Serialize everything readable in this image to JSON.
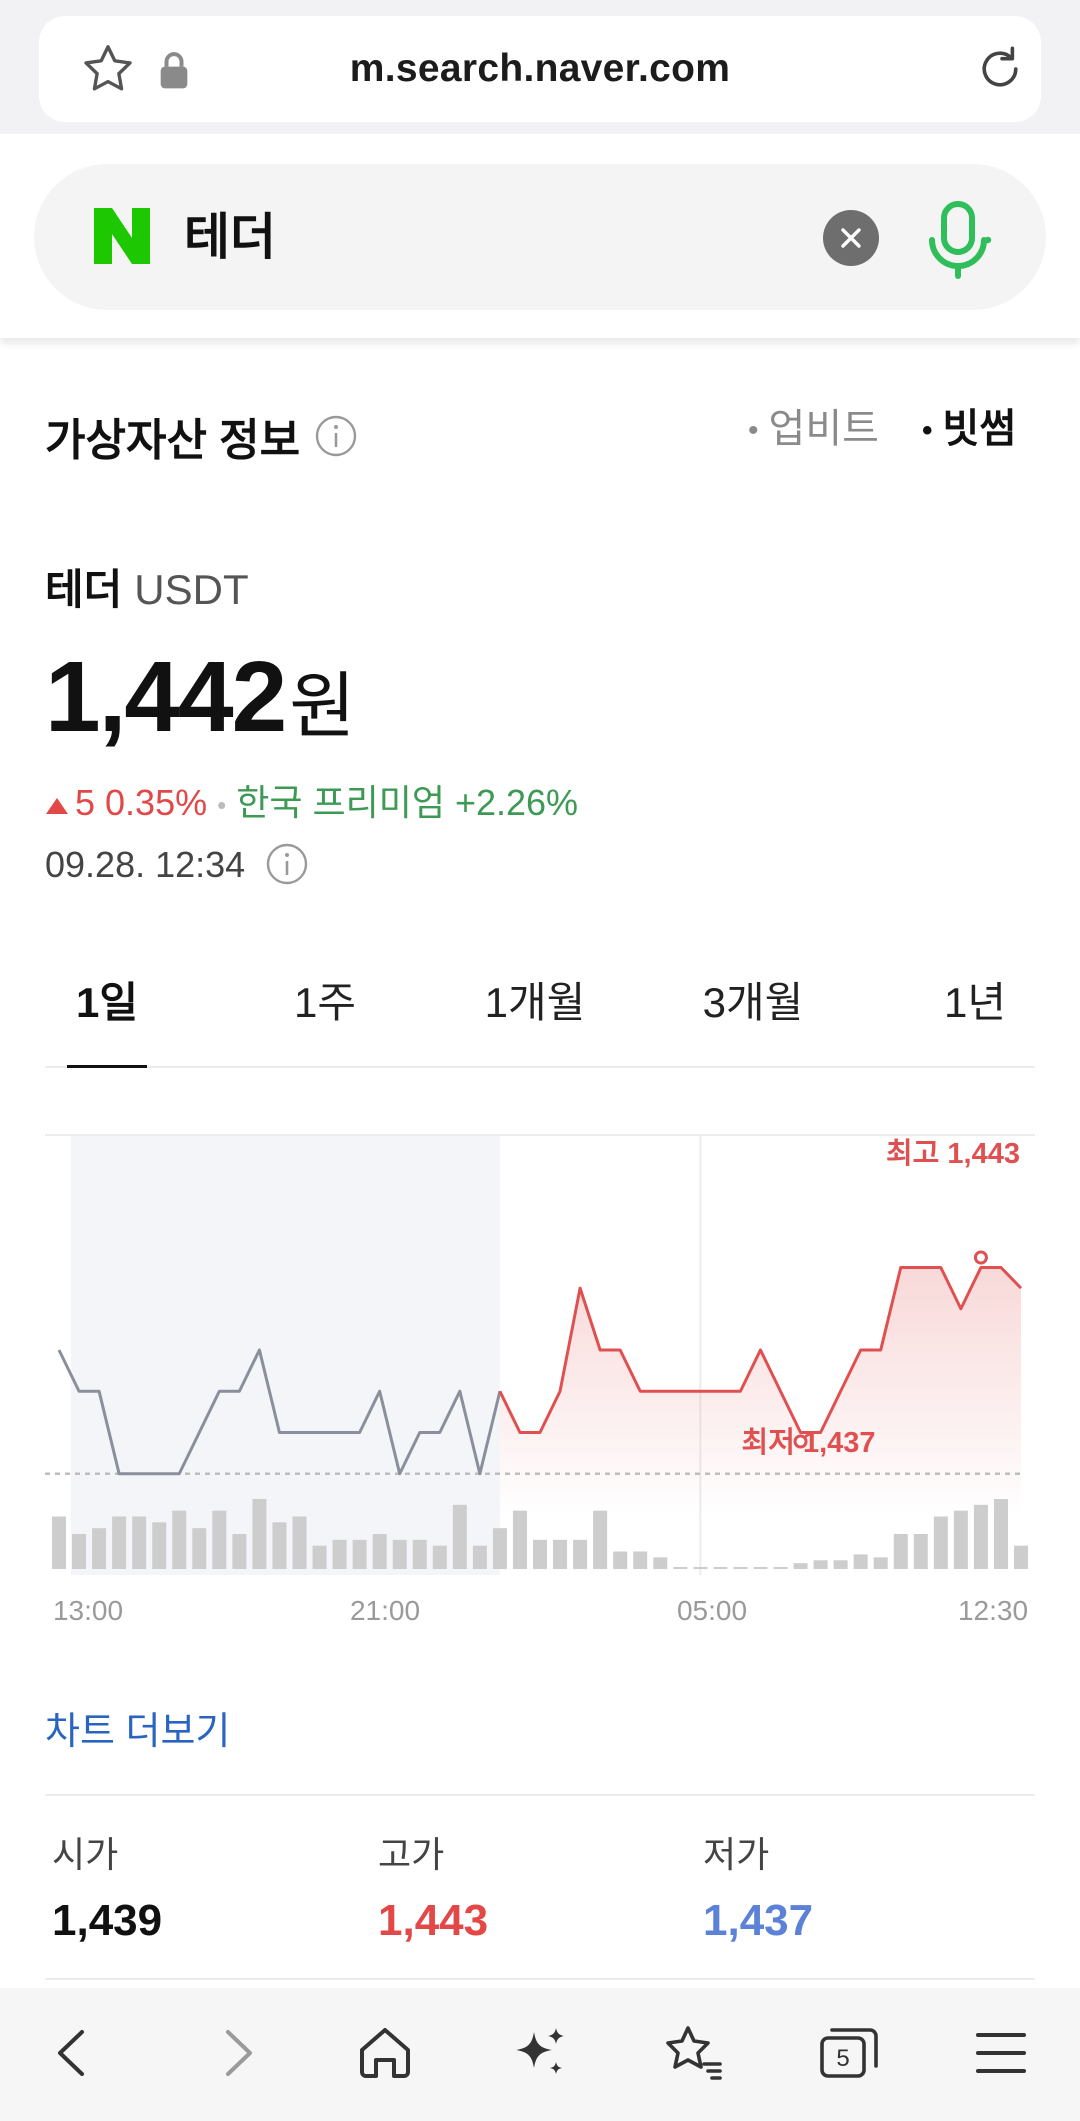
{
  "browser": {
    "url": "m.search.naver.com"
  },
  "search": {
    "query": "테더"
  },
  "section": {
    "title": "가상자산 정보",
    "exchanges": [
      {
        "label": "업비트",
        "selected": false
      },
      {
        "label": "빗썸",
        "selected": true
      }
    ]
  },
  "coin": {
    "name": "테더",
    "symbol": "USDT",
    "price": "1,442",
    "unit": "원",
    "change": "5 0.35%",
    "premium": "한국 프리미엄 +2.26%",
    "timestamp": "09.28. 12:34"
  },
  "tabs": [
    "1일",
    "1주",
    "1개월",
    "3개월",
    "1년"
  ],
  "active_tab": "1일",
  "chart_data": {
    "type": "line",
    "x_ticks": [
      "13:00",
      "21:00",
      "05:00",
      "12:30"
    ],
    "annotations": [
      {
        "label": "최고 1,443",
        "value": 1443
      },
      {
        "label": "최저 1,437",
        "value": 1437
      }
    ],
    "ylim": [
      1436,
      1444
    ],
    "previous_close": 1437,
    "series": [
      {
        "values": [
          1440,
          1439,
          1439,
          1437,
          1437,
          1437,
          1437,
          1438,
          1439,
          1439,
          1440,
          1438,
          1438,
          1438,
          1438,
          1438,
          1439,
          1437,
          1438,
          1438,
          1439,
          1437,
          1439,
          1438,
          1438,
          1439,
          1441.5,
          1440,
          1440,
          1439,
          1439,
          1439,
          1439,
          1439,
          1439,
          1440,
          1439,
          1438,
          1438,
          1439,
          1440,
          1440,
          1442,
          1442,
          1442,
          1441,
          1442,
          1442,
          1441.5
        ],
        "color_past": "#8a8f9c",
        "color_recent": "#e05050"
      }
    ],
    "volume": [
      9,
      6,
      7,
      9,
      9,
      8,
      10,
      7,
      10,
      6,
      12,
      8,
      9,
      4,
      5,
      5,
      6,
      5,
      5,
      4,
      11,
      4,
      7,
      10,
      5,
      5,
      5,
      10,
      3,
      3,
      2,
      0.3,
      0.3,
      0.3,
      0.3,
      0.3,
      0.3,
      1,
      1.5,
      1.5,
      2.5,
      2,
      6,
      6,
      9,
      10,
      11,
      12,
      4
    ]
  },
  "chart_more": "차트 더보기",
  "stats": [
    {
      "label": "시가",
      "value": "1,439",
      "color": "#111111"
    },
    {
      "label": "고가",
      "value": "1,443",
      "color": "#e24848"
    },
    {
      "label": "저가",
      "value": "1,437",
      "color": "#5b82d6"
    }
  ],
  "nav": {
    "tab_count": "5"
  }
}
